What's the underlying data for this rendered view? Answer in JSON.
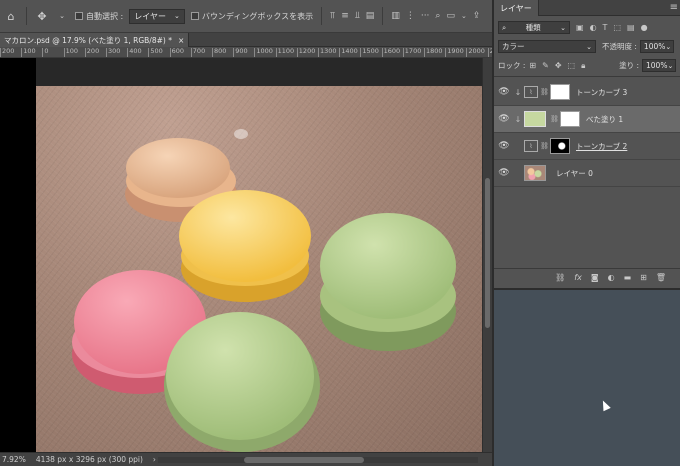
{
  "options_bar": {
    "auto_select_label": "自動選択 :",
    "auto_select_value": "レイヤー",
    "bounding_box_label": "バウンディングボックスを表示"
  },
  "document": {
    "tab_title": "マカロン.psd @ 17.9% (べた塗り 1, RGB/8#) *",
    "tab_close": "×"
  },
  "ruler": {
    "ticks": [
      "200",
      "100",
      "0",
      "100",
      "200",
      "300",
      "400",
      "500",
      "600",
      "700",
      "800",
      "900",
      "1000",
      "1100",
      "1200",
      "1300",
      "1400",
      "1500",
      "1600",
      "1700",
      "1800",
      "1900",
      "2000",
      "2100",
      "2200"
    ]
  },
  "status": {
    "zoom": "7.92%",
    "doc_size": "4138 px x 3296 px (300 ppi)",
    "arrow": "›"
  },
  "panel": {
    "tab_label": "レイヤー",
    "filter_type": "種類",
    "blend_mode": "カラー",
    "opacity_label": "不透明度 :",
    "opacity_value": "100%",
    "lock_label": "ロック :",
    "fill_label": "塗り :",
    "fill_value": "100%",
    "layers": [
      {
        "name": "トーンカーブ 3",
        "selected": false,
        "clipped": true,
        "type": "adjustment"
      },
      {
        "name": "べた塗り 1",
        "selected": true,
        "clipped": true,
        "type": "fill",
        "swatch_color": "#c6d8a0"
      },
      {
        "name": "トーンカーブ 2",
        "selected": false,
        "clipped": false,
        "type": "adjustment"
      },
      {
        "name": "レイヤー 0",
        "selected": false,
        "clipped": false,
        "type": "pixel"
      }
    ]
  },
  "colors": {
    "ui_bg": "#535353",
    "selected_layer": "#6a6a6a",
    "fill_swatch": "#c6d8a0"
  }
}
